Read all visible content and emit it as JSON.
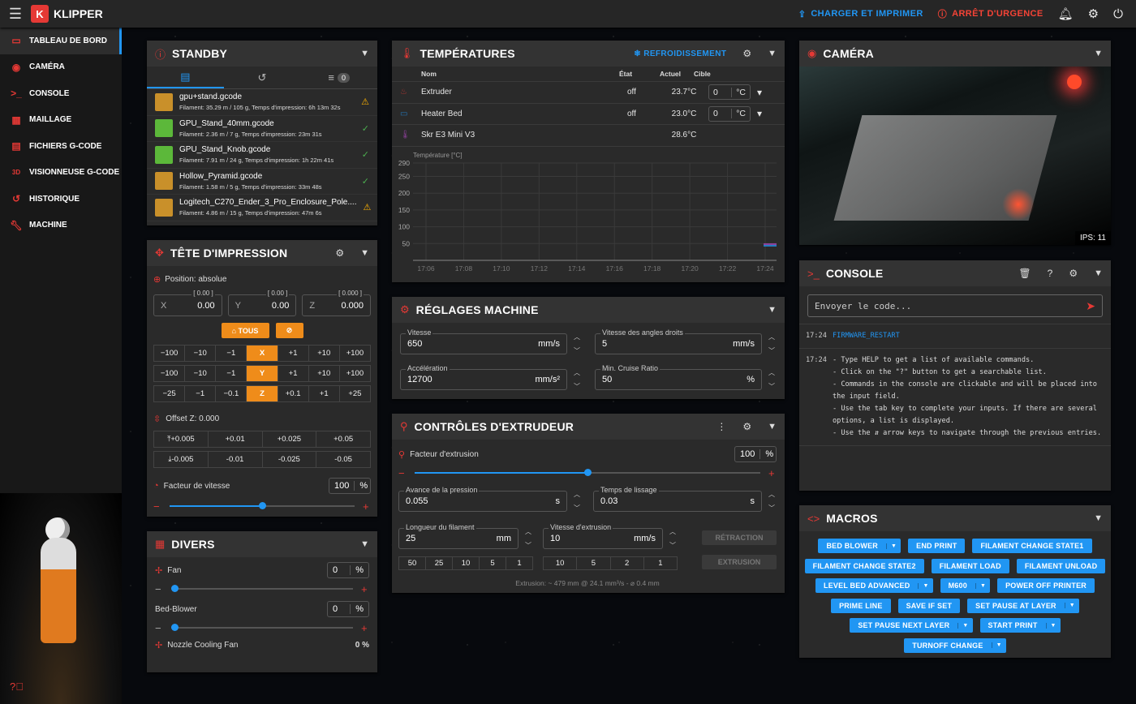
{
  "header": {
    "app": "KLIPPER",
    "upload": "CHARGER ET IMPRIMER",
    "estop": "ARRÊT D'URGENCE"
  },
  "sidebar": [
    "TABLEAU DE BORD",
    "CAMÉRA",
    "CONSOLE",
    "MAILLAGE",
    "FICHIERS G-CODE",
    "VISIONNEUSE G-CODE",
    "HISTORIQUE",
    "MACHINE"
  ],
  "standby": {
    "title": "STANDBY",
    "queue_count": "0",
    "files": [
      {
        "name": "gpu+stand.gcode",
        "meta": "Filament: 35.29 m / 105 g, Temps d'impression: 6h 13m 32s",
        "status": "warn"
      },
      {
        "name": "GPU_Stand_40mm.gcode",
        "meta": "Filament: 2.36 m / 7 g, Temps d'impression: 23m 31s",
        "status": "ok"
      },
      {
        "name": "GPU_Stand_Knob.gcode",
        "meta": "Filament: 7.91 m / 24 g, Temps d'impression: 1h 22m 41s",
        "status": "ok"
      },
      {
        "name": "Hollow_Pyramid.gcode",
        "meta": "Filament: 1.58 m / 5 g, Temps d'impression: 33m 48s",
        "status": "ok"
      },
      {
        "name": "Logitech_C270_Ender_3_Pro_Enclosure_Pole....",
        "meta": "Filament: 4.86 m / 15 g, Temps d'impression: 47m 6s",
        "status": "warn"
      }
    ]
  },
  "toolhead": {
    "title": "TÊTE D'IMPRESSION",
    "position": "Position: absolue",
    "axes": [
      {
        "l": "X",
        "v": "0.00",
        "h": "[ 0.00 ]"
      },
      {
        "l": "Y",
        "v": "0.00",
        "h": "[ 0.00 ]"
      },
      {
        "l": "Z",
        "v": "0.000",
        "h": "[ 0.000 ]"
      }
    ],
    "home_all": "TOUS",
    "xrow": [
      "−100",
      "−10",
      "−1",
      "X",
      "+1",
      "+10",
      "+100"
    ],
    "yrow": [
      "−100",
      "−10",
      "−1",
      "Y",
      "+1",
      "+10",
      "+100"
    ],
    "zrow": [
      "−25",
      "−1",
      "−0.1",
      "Z",
      "+0.1",
      "+1",
      "+25"
    ],
    "offset_label": "Offset Z: 0.000",
    "offset_up": [
      "+0.005",
      "+0.01",
      "+0.025",
      "+0.05"
    ],
    "offset_down": [
      "-0.005",
      "-0.01",
      "-0.025",
      "-0.05"
    ],
    "speed_label": "Facteur de vitesse",
    "speed_value": "100",
    "speed_unit": "%",
    "speed_frac": 0.5
  },
  "misc": {
    "title": "DIVERS",
    "fans": [
      {
        "name": "Fan",
        "value": "0",
        "unit": "%"
      },
      {
        "name": "Bed-Blower",
        "value": "0",
        "unit": "%"
      }
    ],
    "nozzle": {
      "name": "Nozzle Cooling Fan",
      "value": "0 %"
    }
  },
  "temps": {
    "title": "TEMPÉRATURES",
    "cooldown": "REFROIDISSEMENT",
    "cols": [
      "Nom",
      "État",
      "Actuel",
      "Cible"
    ],
    "rows": [
      {
        "name": "Extruder",
        "state": "off",
        "actual": "23.7°C",
        "target": "0",
        "unit": "°C"
      },
      {
        "name": "Heater Bed",
        "state": "off",
        "actual": "23.0°C",
        "target": "0",
        "unit": "°C"
      },
      {
        "name": "Skr E3 Mini V3",
        "state": "",
        "actual": "28.6°C",
        "target": "",
        "unit": ""
      }
    ],
    "chart_label": "Température [°C]",
    "yticks": [
      "290",
      "250",
      "200",
      "150",
      "100",
      "50"
    ],
    "xticks": [
      "17:06",
      "17:08",
      "17:10",
      "17:12",
      "17:14",
      "17:16",
      "17:18",
      "17:20",
      "17:22",
      "17:24"
    ]
  },
  "machine": {
    "title": "RÉGLAGES MACHINE",
    "fields": [
      {
        "label": "Vitesse",
        "value": "650",
        "unit": "mm/s"
      },
      {
        "label": "Vitesse des angles droits",
        "value": "5",
        "unit": "mm/s"
      },
      {
        "label": "Accélération",
        "value": "12700",
        "unit": "mm/s²"
      },
      {
        "label": "Min. Cruise Ratio",
        "value": "50",
        "unit": "%"
      }
    ]
  },
  "extruder": {
    "title": "CONTRÔLES D'EXTRUDEUR",
    "factor_label": "Facteur d'extrusion",
    "factor_value": "100",
    "factor_unit": "%",
    "factor_frac": 0.5,
    "pa_label": "Avance de la pression",
    "pa_value": "0.055",
    "pa_unit": "s",
    "st_label": "Temps de lissage",
    "st_value": "0.03",
    "st_unit": "s",
    "len_label": "Longueur du filament",
    "len_value": "25",
    "len_unit": "mm",
    "vel_label": "Vitesse d'extrusion",
    "vel_value": "10",
    "vel_unit": "mm/s",
    "len_presets": [
      "50",
      "25",
      "10",
      "5",
      "1"
    ],
    "vel_presets": [
      "10",
      "5",
      "2",
      "1"
    ],
    "retract": "RÉTRACTION",
    "extrude": "EXTRUSION",
    "info": "Extrusion: ~ 479 mm @ 24.1 mm³/s - ⌀ 0.4 mm"
  },
  "camera": {
    "title": "CAMÉRA",
    "fps": "IPS: 11"
  },
  "console": {
    "title": "CONSOLE",
    "placeholder": "Envoyer le code...",
    "entries": [
      {
        "time": "17:24",
        "lines": [
          "FIRMWARE_RESTART"
        ]
      },
      {
        "time": "17:24",
        "lines": [
          "- Type HELP to get a list of available commands.",
          "- Click on the \"?\" button to get a searchable list.",
          "- Commands in the console are clickable and will be placed into",
          "the input field.",
          "- Use the tab key to complete your inputs. If there are several",
          "options, a list is displayed.",
          "- Use the ⇵ arrow keys to navigate through the previous entries."
        ]
      }
    ]
  },
  "macros": {
    "title": "MACROS",
    "rows": [
      [
        {
          "t": "BED BLOWER",
          "dd": true
        },
        {
          "t": "END PRINT"
        },
        {
          "t": "FILAMENT CHANGE STATE1"
        }
      ],
      [
        {
          "t": "FILAMENT CHANGE STATE2"
        },
        {
          "t": "FILAMENT LOAD"
        },
        {
          "t": "FILAMENT UNLOAD"
        }
      ],
      [
        {
          "t": "LEVEL BED ADVANCED",
          "dd": true
        },
        {
          "t": "M600",
          "dd": true
        },
        {
          "t": "POWER OFF PRINTER"
        }
      ],
      [
        {
          "t": "PRIME LINE"
        },
        {
          "t": "SAVE IF SET"
        },
        {
          "t": "SET PAUSE AT LAYER",
          "dd": true
        }
      ],
      [
        {
          "t": "SET PAUSE NEXT LAYER",
          "dd": true
        },
        {
          "t": "START PRINT",
          "dd": true
        }
      ],
      [
        {
          "t": "TURNOFF CHANGE",
          "dd": true
        }
      ]
    ]
  }
}
